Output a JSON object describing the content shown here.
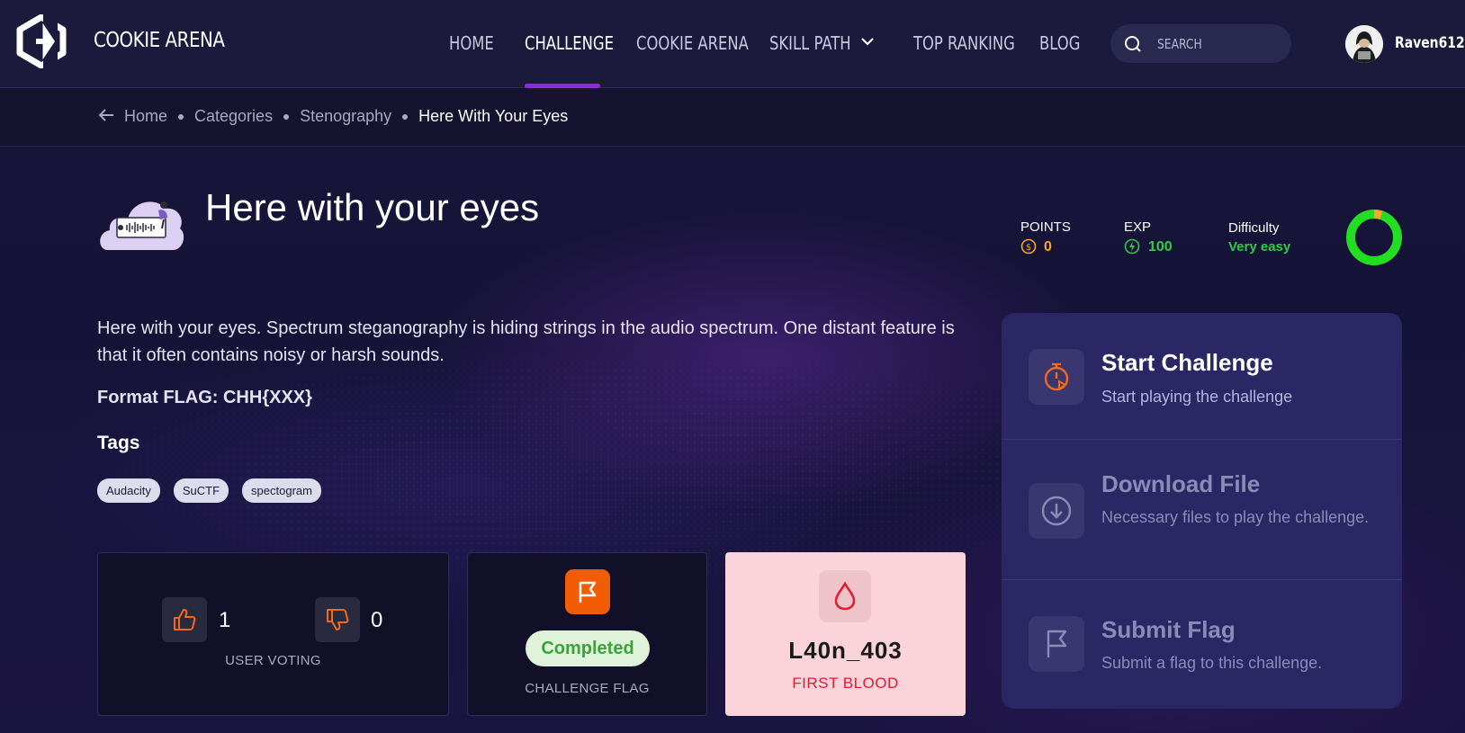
{
  "app": {
    "brand": "COOKIE ARENA"
  },
  "nav": {
    "items": [
      {
        "label": "HOME",
        "active": false
      },
      {
        "label": "CHALLENGE",
        "active": true
      },
      {
        "label": "COOKIE ARENA",
        "active": false
      },
      {
        "label": "SKILL PATH",
        "active": false,
        "has_dropdown": true
      },
      {
        "label": "TOP RANKING",
        "active": false
      },
      {
        "label": "BLOG",
        "active": false
      }
    ],
    "search": {
      "placeholder": "SEARCH",
      "value": ""
    },
    "user": {
      "name": "Raven612"
    }
  },
  "breadcrumb": {
    "items": [
      "Home",
      "Categories",
      "Stenography"
    ],
    "current": "Here With Your Eyes"
  },
  "challenge": {
    "title": "Here with your eyes",
    "description": "Here with your eyes. Spectrum steganography is hiding strings in the audio spectrum. One distant feature is that it often contains noisy or harsh sounds.",
    "format_flag": "Format FLAG: CHH{XXX}",
    "tags_title": "Tags",
    "tags": [
      "Audacity",
      "SuCTF",
      "spectogram"
    ]
  },
  "stats": {
    "points_label": "POINTS",
    "points_value": "0",
    "exp_label": "EXP",
    "exp_value": "100",
    "difficulty_label": "Difficulty",
    "difficulty_value": "Very easy",
    "difficulty_gauge_fraction": 0.05
  },
  "voting": {
    "likes": "1",
    "dislikes": "0",
    "caption": "USER VOTING"
  },
  "flag_card": {
    "status": "Completed",
    "caption": "CHALLENGE FLAG"
  },
  "first_blood": {
    "user": "L40n_403",
    "caption": "FIRST BLOOD"
  },
  "actions": {
    "start": {
      "title": "Start Challenge",
      "subtitle": "Start playing the challenge"
    },
    "download": {
      "title": "Download File",
      "subtitle": "Necessary files to play the challenge."
    },
    "submit": {
      "title": "Submit Flag",
      "subtitle": "Submit a flag to this challenge."
    }
  },
  "colors": {
    "accent": "#8a2be2",
    "points": "#f5a623",
    "exp": "#2ecc40",
    "difficulty": "#2ecc40",
    "flag_orange": "#f25c05",
    "first_blood_red": "#e11d2e"
  },
  "icons": [
    "logo-icon",
    "chevron-down-icon",
    "search-icon",
    "avatar",
    "arrow-left-icon",
    "coin-icon",
    "bolt-icon",
    "thumbs-up-icon",
    "thumbs-down-icon",
    "flag-icon",
    "blood-drop-icon",
    "stopwatch-icon",
    "download-icon"
  ]
}
